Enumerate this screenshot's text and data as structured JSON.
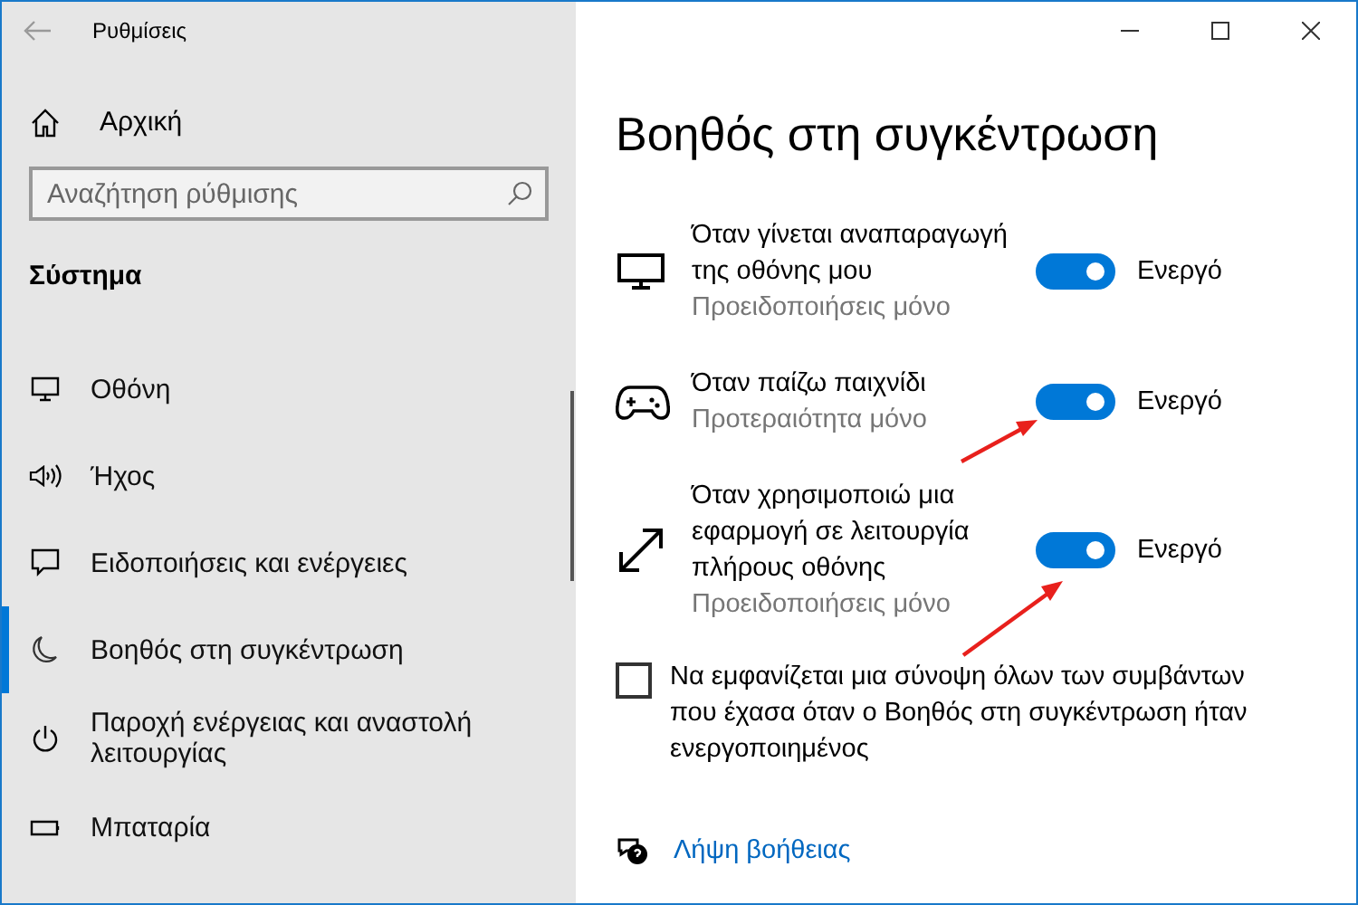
{
  "window": {
    "title": "Ρυθμίσεις"
  },
  "sidebar": {
    "home": "Αρχική",
    "search": {
      "placeholder": "Αναζήτηση ρύθμισης"
    },
    "section": "Σύστημα",
    "items": [
      {
        "label": "Οθόνη",
        "selected": false
      },
      {
        "label": "Ήχος",
        "selected": false
      },
      {
        "label": "Ειδοποιήσεις και ενέργειες",
        "selected": false
      },
      {
        "label": "Βοηθός στη συγκέντρωση",
        "selected": true
      },
      {
        "label": "Παροχή ενέργειας και αναστολή λειτουργίας",
        "selected": false
      },
      {
        "label": "Μπαταρία",
        "selected": false
      }
    ]
  },
  "page": {
    "title": "Βοηθός στη συγκέντρωση",
    "rules": [
      {
        "title": "Όταν γίνεται αναπαραγωγή της οθόνης μου",
        "subtitle": "Προειδοποιήσεις μόνο",
        "on": true,
        "state": "Ενεργό"
      },
      {
        "title": "Όταν παίζω παιχνίδι",
        "subtitle": "Προτεραιότητα μόνο",
        "on": true,
        "state": "Ενεργό"
      },
      {
        "title": "Όταν χρησιμοποιώ μια εφαρμογή σε λειτουργία πλήρους οθόνης",
        "subtitle": "Προειδοποιήσεις μόνο",
        "on": true,
        "state": "Ενεργό"
      }
    ],
    "summary": {
      "label": "Να εμφανίζεται μια σύνοψη όλων των συμβάντων που έχασα όταν ο Βοηθός στη συγκέντρωση ήταν ενεργοποιημένος",
      "checked": false
    },
    "help": "Λήψη βοήθειας"
  }
}
